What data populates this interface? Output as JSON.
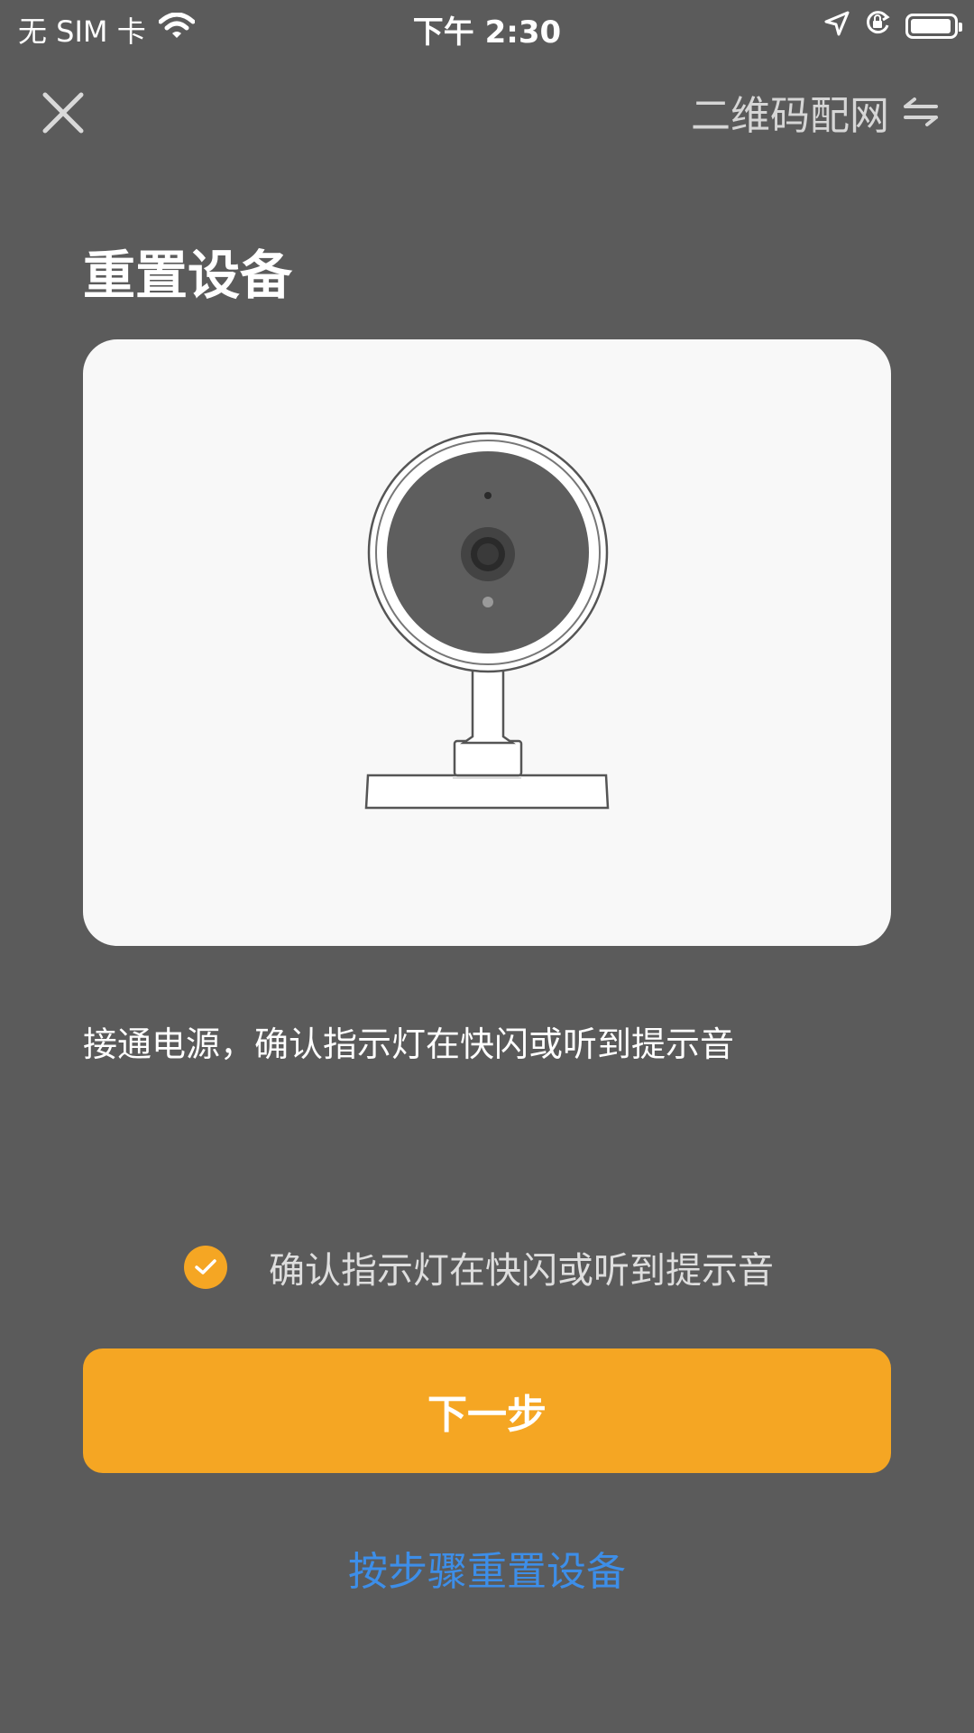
{
  "status_bar": {
    "carrier": "无 SIM 卡",
    "time": "下午 2:30"
  },
  "nav": {
    "mode_switch_label": "二维码配网"
  },
  "page": {
    "title": "重置设备",
    "instruction": "接通电源，确认指示灯在快闪或听到提示音"
  },
  "confirm": {
    "label": "确认指示灯在快闪或听到提示音",
    "checked": true
  },
  "buttons": {
    "next": "下一步",
    "reset_steps": "按步骤重置设备"
  },
  "colors": {
    "background": "#5b5b5b",
    "accent": "#f5a623",
    "link": "#3d8ee8",
    "card": "#f8f8f8"
  },
  "icons": [
    "wifi-icon",
    "location-arrow-icon",
    "rotation-lock-icon",
    "battery-icon",
    "close-icon",
    "swap-arrows-icon",
    "checkmark-icon"
  ]
}
